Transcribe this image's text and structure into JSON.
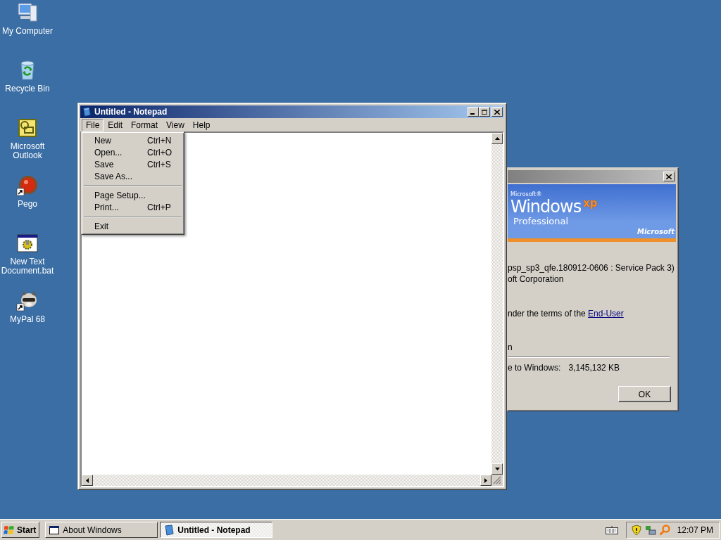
{
  "desktop_icons": [
    {
      "kind": "computer",
      "label": "My Computer",
      "shortcut": false
    },
    {
      "kind": "recycle-bin",
      "label": "Recycle Bin",
      "shortcut": false
    },
    {
      "kind": "outlook",
      "label": "Microsoft Outlook",
      "shortcut": false
    },
    {
      "kind": "ball",
      "label": "Pego",
      "shortcut": true
    },
    {
      "kind": "batch",
      "label": "New Text Document.bat",
      "shortcut": false
    },
    {
      "kind": "animal",
      "label": "MyPal 68",
      "shortcut": true
    }
  ],
  "notepad": {
    "title": "Untitled - Notepad",
    "menu": [
      {
        "label": "File",
        "selected": true
      },
      {
        "label": "Edit",
        "selected": false
      },
      {
        "label": "Format",
        "selected": false
      },
      {
        "label": "View",
        "selected": false
      },
      {
        "label": "Help",
        "selected": false
      }
    ],
    "file_menu": [
      {
        "kind": "item",
        "label": "New",
        "shortcut": "Ctrl+N"
      },
      {
        "kind": "item",
        "label": "Open...",
        "shortcut": "Ctrl+O"
      },
      {
        "kind": "item",
        "label": "Save",
        "shortcut": "Ctrl+S"
      },
      {
        "kind": "item",
        "label": "Save As..."
      },
      {
        "kind": "separator"
      },
      {
        "kind": "item",
        "label": "Page Setup..."
      },
      {
        "kind": "item",
        "label": "Print...",
        "shortcut": "Ctrl+P"
      },
      {
        "kind": "separator"
      },
      {
        "kind": "item",
        "label": "Exit"
      }
    ]
  },
  "about_dialog": {
    "banner": {
      "brand": "Microsoft®",
      "product": "Windows",
      "mark": "xp",
      "edition": "Professional",
      "maker": "Microsoft"
    },
    "version_lines": [
      "psp_sp3_qfe.180912-0606 : Service Pack 3)",
      "oft Corporation"
    ],
    "license": {
      "text": "nder the terms of the ",
      "link": "End-User"
    },
    "licensee": "n",
    "memory": {
      "label": "e to Windows:",
      "value": "3,145,132 KB"
    },
    "ok_button": "OK"
  },
  "taskbar": {
    "start": "Start",
    "tasks": [
      {
        "kind": "window",
        "label": "About Windows",
        "selected": false
      },
      {
        "kind": "notepad",
        "label": "Untitled - Notepad",
        "selected": true
      }
    ],
    "clock": "12:07 PM"
  }
}
